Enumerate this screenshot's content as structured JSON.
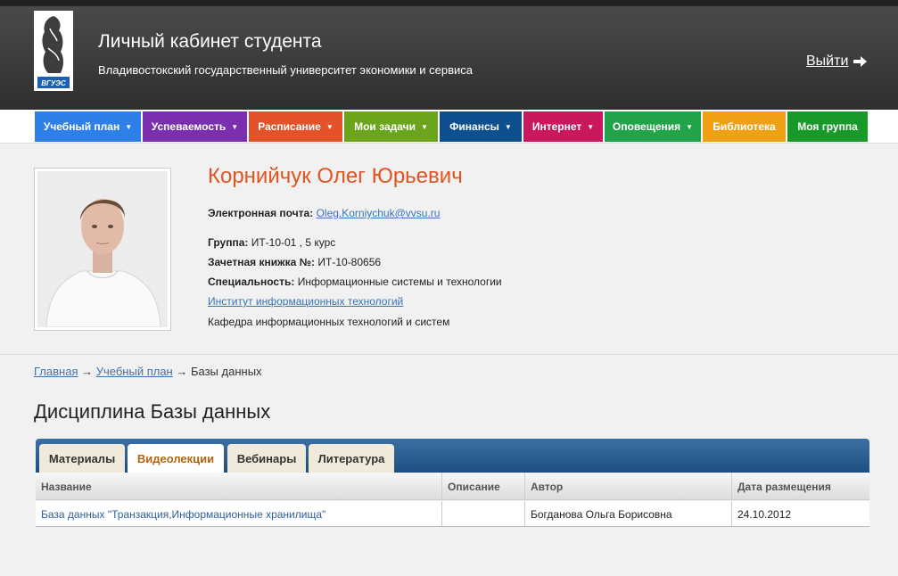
{
  "header": {
    "title": "Личный кабинет студента",
    "subtitle": "Владивостокский государственный университет экономики и сервиса",
    "logo_text": "ВГУЭС",
    "logout": "Выйти"
  },
  "nav": [
    {
      "label": "Учебный план",
      "caret": "▼",
      "color": "#2f7fe8"
    },
    {
      "label": "Успеваемость",
      "caret": "▼",
      "color": "#7a2fb0"
    },
    {
      "label": "Расписание",
      "caret": "▼",
      "color": "#e4522a"
    },
    {
      "label": "Мои задачи",
      "caret": "▼",
      "color": "#6aa51b"
    },
    {
      "label": "Финансы",
      "caret": "▼",
      "color": "#0e4f8e"
    },
    {
      "label": "Интернет",
      "caret": "▼",
      "color": "#c9185d"
    },
    {
      "label": "Оповещения",
      "caret": "▼",
      "color": "#21a349"
    },
    {
      "label": "Библиотека",
      "caret": "",
      "color": "#f0a015"
    },
    {
      "label": "Моя группа",
      "caret": "",
      "color": "#189a2a"
    }
  ],
  "profile": {
    "name": "Корнийчук Олег Юрьевич",
    "email_label": "Электронная почта:",
    "email": "Oleg.Korniychuk@vvsu.ru",
    "group_label": "Группа:",
    "group": "ИТ-10-01 , 5 курс",
    "record_label": "Зачетная книжка №:",
    "record": "ИТ-10-80656",
    "specialty_label": "Специальность:",
    "specialty": "Информационные системы и технологии",
    "institute": "Институт информационных технологий",
    "department": "Кафедра информационных технологий и систем"
  },
  "breadcrumb": {
    "home": "Главная",
    "sep1": "→",
    "plan": "Учебный план",
    "sep2": "→",
    "current": "Базы данных"
  },
  "page_title": "Дисциплина Базы данных",
  "tabs": [
    "Материалы",
    "Видеолекции",
    "Вебинары",
    "Литература"
  ],
  "table": {
    "headers": [
      "Название",
      "Описание",
      "Автор",
      "Дата размещения"
    ],
    "rows": [
      [
        "База данных \"Транзакция,Информационные хранилища\"",
        "",
        "Богданова Ольга Борисовна",
        "24.10.2012"
      ]
    ]
  },
  "colors": {
    "accent_name": "#e2541f",
    "link": "#3a74b6",
    "active_tab": "#b46310"
  }
}
